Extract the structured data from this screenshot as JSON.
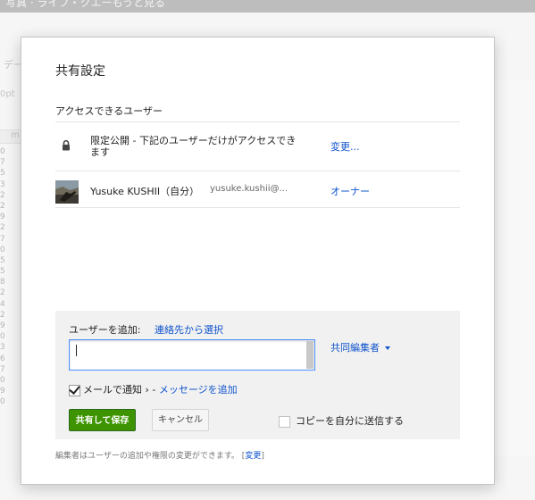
{
  "background": {
    "window_title": "写真 · ライフ・クエーもうと見る",
    "toolbar_label": "デー",
    "font_size_field": "0pt",
    "column_header": "m",
    "row_numbers": [
      "0",
      "7",
      "5",
      "3",
      "2",
      "2",
      "9",
      "2",
      "7",
      "0",
      "5",
      "5",
      "8",
      "2",
      "4",
      "2",
      "9",
      "0",
      "3",
      "6",
      "7",
      "0",
      "9",
      "0"
    ]
  },
  "dialog": {
    "title": "共有設定",
    "access_section_title": "アクセスできるユーザー",
    "access": {
      "icon": "lock-icon",
      "description": "限定公開 - 下記のユーザーだけがアクセスできます",
      "change_label": "変更..."
    },
    "owner": {
      "icon": "avatar",
      "name": "Yusuke KUSHII（自分）",
      "email": "yusuke.kushii@...",
      "role": "オーナー"
    },
    "add_people": {
      "label": "ユーザーを追加:",
      "contacts_link": "連絡先から選択",
      "input_value": "",
      "role_label": "共同編集者",
      "notify_checked": true,
      "notify_label": "メールで通知",
      "notify_separator": "› -",
      "add_message_label": "メッセージを追加",
      "save_button": "共有して保存",
      "cancel_button": "キャンセル",
      "copy_checked": false,
      "copy_label": "コピーを自分に送信する"
    },
    "footer": {
      "note": "編集者はユーザーの追加や権限の変更ができます。",
      "link_open": "[",
      "link_label": "変更",
      "link_close": "]"
    }
  },
  "colors": {
    "link": "#1155cc",
    "primary_button": "#3d9400",
    "input_focus": "#4d90fe"
  }
}
